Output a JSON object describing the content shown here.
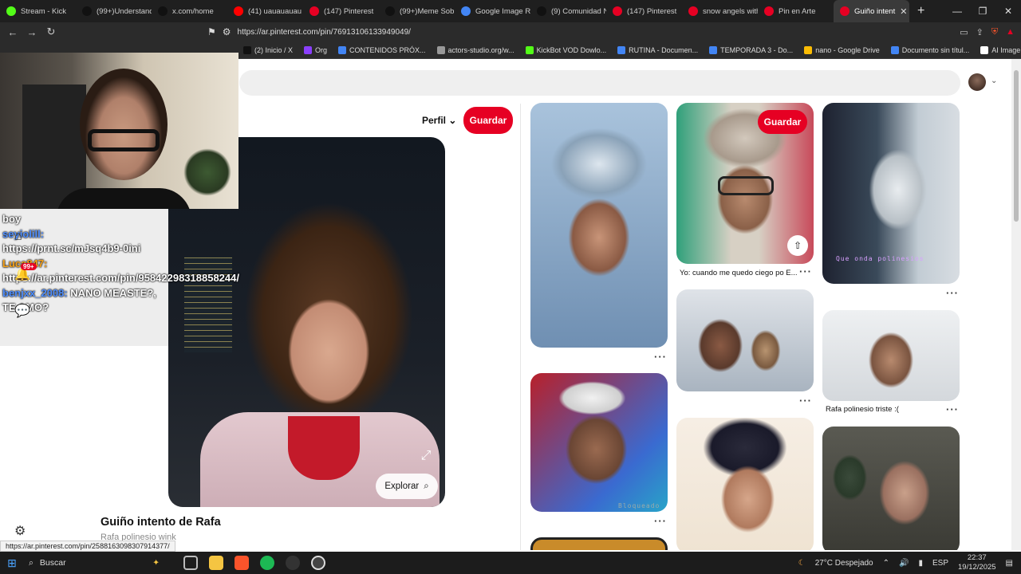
{
  "browser": {
    "tabs": [
      {
        "label": "Stream - Kick",
        "color": "#53fc18",
        "active": false
      },
      {
        "label": "(99+)Understand",
        "color": "#111111",
        "active": false
      },
      {
        "label": "x.com/home",
        "color": "#111111",
        "active": false
      },
      {
        "label": "(41) uauauauau",
        "color": "#ff0000",
        "active": false
      },
      {
        "label": "(147) Pinterest",
        "color": "#e60023",
        "active": false
      },
      {
        "label": "(99+)Meme Sob",
        "color": "#111111",
        "active": false
      },
      {
        "label": "Google Image Re",
        "color": "#4285f4",
        "active": false
      },
      {
        "label": "(9) Comunidad N",
        "color": "#111111",
        "active": false
      },
      {
        "label": "(147) Pinterest",
        "color": "#e60023",
        "active": false
      },
      {
        "label": "snow angels with",
        "color": "#e60023",
        "active": false
      },
      {
        "label": "Pin en Arte",
        "color": "#e60023",
        "active": false
      },
      {
        "label": "Guiño intent",
        "color": "#e60023",
        "active": true
      }
    ],
    "url": "https://ar.pinterest.com/pin/76913106133949049/",
    "bookmarks": [
      {
        "label": "(2) Inicio / X",
        "color": "#111111"
      },
      {
        "label": "Org",
        "color": "#8a3ffc"
      },
      {
        "label": "CONTENIDOS PRÓX...",
        "color": "#4285f4"
      },
      {
        "label": "actors-studio.org/w...",
        "color": "#999999"
      },
      {
        "label": "KickBot VOD Dowlo...",
        "color": "#53fc18"
      },
      {
        "label": "RUTINA - Documen...",
        "color": "#4285f4"
      },
      {
        "label": "TEMPORADA 3 - Do...",
        "color": "#4285f4"
      },
      {
        "label": "nano - Google Drive",
        "color": "#fbbc04"
      },
      {
        "label": "Documento sin títul...",
        "color": "#4285f4"
      },
      {
        "label": "AI Image Upscaler |...",
        "color": "#ffffff"
      }
    ]
  },
  "pin": {
    "perfil_label": "Perfil",
    "save_label": "Guardar",
    "explore_label": "Explorar",
    "title": "Guiño intento de Rafa",
    "subtitle": "Rafa polinesio wink"
  },
  "grid": {
    "save_label": "Guardar",
    "captions": {
      "glasses": "Yo: cuando me quedo ciego po E...",
      "crying": "Rafa polinesio triste :("
    },
    "overlay_text": "Que onda polinesios",
    "watermark": "Bloqueado"
  },
  "chat": {
    "lines": [
      {
        "user": "",
        "text": "boy"
      },
      {
        "user": "seyiolill:",
        "text": "https://prnt.sc/mJsq4b9-0ini"
      },
      {
        "user": "Luca847:",
        "text": "https://ar.pinterest.com/pin/95842298318858244/"
      },
      {
        "user": "benjxx_2008:",
        "text": "NANO MEASTE?, TE AMO?"
      }
    ],
    "badge": "99+"
  },
  "status_url": "https://ar.pinterest.com/pin/2588163098307914377/",
  "taskbar": {
    "search_label": "Buscar",
    "weather": "27°C  Despejado",
    "lang": "ESP",
    "time": "22:37",
    "date": "19/12/2025"
  }
}
